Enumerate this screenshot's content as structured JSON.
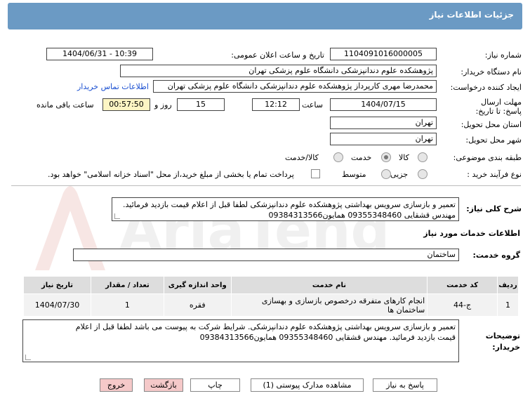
{
  "header": {
    "title": "جزئیات اطلاعات نیاز"
  },
  "form": {
    "need_number_label": "شماره نیاز:",
    "need_number": "1104091016000005",
    "announce_label": "تاریخ و ساعت اعلان عمومی:",
    "announce_value": "1404/06/31 - 10:39",
    "buyer_org_label": "نام دستگاه خریدار:",
    "buyer_org": "پژوهشکده علوم دندانپزشکی دانشگاه علوم پزشکی تهران",
    "creator_label": "ایجاد کننده درخواست:",
    "creator": "محمدرضا مهری کارپرداز پژوهشکده علوم دندانپزشکی دانشگاه علوم پزشکی تهران",
    "contact_link": "اطلاعات تماس خریدار",
    "deadline_label": "مهلت ارسال پاسخ: تا تاریخ:",
    "deadline_date": "1404/07/15",
    "time_label": "ساعت",
    "deadline_time": "12:12",
    "days_value": "15",
    "days_label": "روز و",
    "remaining_time": "00:57:50",
    "remaining_label": "ساعت باقی مانده",
    "province_label": "استان محل تحویل:",
    "province": "تهران",
    "city_label": "شهر محل تحویل:",
    "city": "تهران",
    "category_label": "طبقه بندی موضوعی:",
    "category_options": [
      "کالا",
      "خدمت",
      "کالا/خدمت"
    ],
    "category_selected": "خدمت",
    "process_label": "نوع فرآیند خرید :",
    "process_options": [
      "جزیی",
      "متوسط"
    ],
    "process_selected": "جزیی",
    "payment_note": "پرداخت تمام یا بخشی از مبلغ خرید،از محل \"اسناد خزانه اسلامی\" خواهد بود."
  },
  "summary": {
    "label": "شرح کلی نیاز:",
    "line1": "تعمیر و بازسازی سرویس بهداشتی پژوهشکده علوم دندانپزشکی  لطفا قبل از اعلام قیمت بازدید فرمائید.",
    "line2": "مهندس قشقایی 09355348460  همایون09384313566"
  },
  "services": {
    "section_title": "اطلاعات خدمات مورد نیاز",
    "group_label": "گروه خدمت:",
    "group_value": "ساختمان",
    "columns": [
      "ردیف",
      "کد خدمت",
      "نام خدمت",
      "واحد اندازه گیری",
      "تعداد / مقدار",
      "تاریخ نیاز"
    ],
    "rows": [
      {
        "row": "1",
        "code": "ج-44",
        "name": "انجام کارهای متفرقه درخصوص بازسازی و بهسازی ساختمان ها",
        "unit": "فقره",
        "qty": "1",
        "date": "1404/07/30"
      }
    ]
  },
  "buyer_notes": {
    "label": "توضیحات خریدار:",
    "line1": "تعمیر و بازسازی سرویس بهداشتی پژوهشکده علوم دندانپزشکی. شرایط شرکت به پیوست می باشد لطفا قبل از اعلام",
    "line2": "قیمت بازدید فرمائید. مهندس قشقایی 09355348460  همایون09384313566"
  },
  "buttons": {
    "reply": "پاسخ به نیاز",
    "attachments": "مشاهده مدارک پیوستی (1)",
    "print": "چاپ",
    "back": "بازگشت",
    "exit": "خروج"
  },
  "watermark": {
    "text": "AriaTender.net"
  },
  "colors": {
    "header": "#6b9ac4",
    "remaining_bg": "#fdf5c4",
    "pink_button": "#f5c9c9",
    "table_header": "#dddddd",
    "link": "#1a4fd1"
  },
  "icons": {
    "watermark_logo": "aria-tender-logo"
  }
}
